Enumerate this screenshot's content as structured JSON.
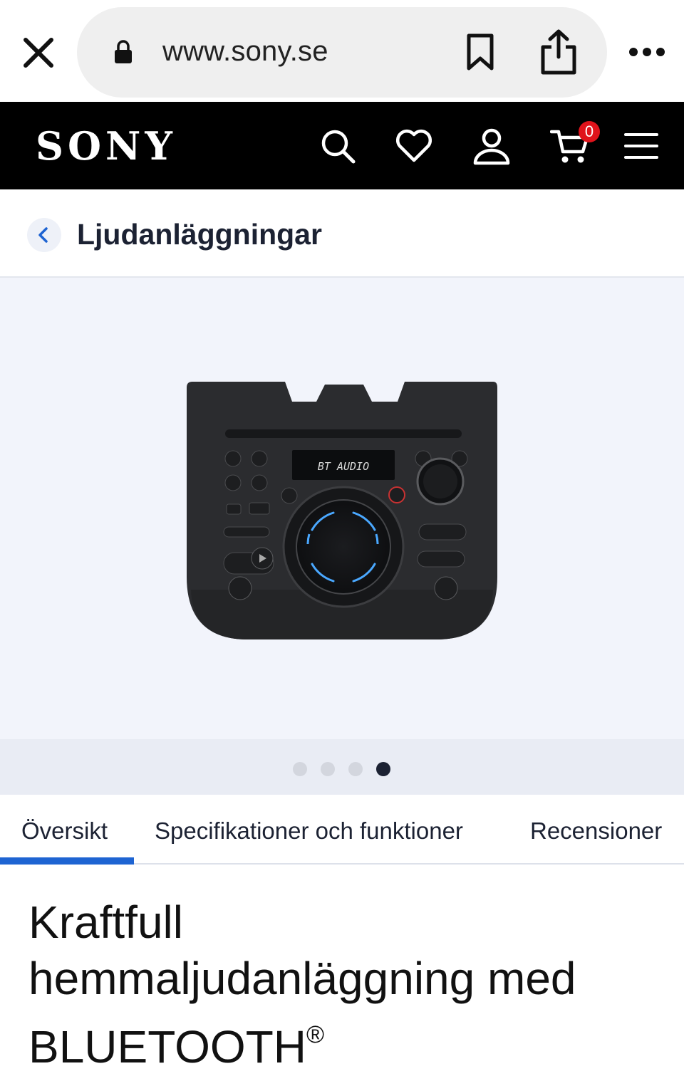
{
  "browser": {
    "url": "www.sony.se",
    "icons": {
      "close": "close-icon",
      "lock": "lock-icon",
      "bookmark": "bookmark-icon",
      "share": "share-icon",
      "more": "more-icon"
    }
  },
  "header": {
    "logo": "SONY",
    "cart_count": "0",
    "icons": [
      "search-icon",
      "heart-icon",
      "user-icon",
      "cart-icon",
      "menu-icon"
    ],
    "badge_color": "#e0131b"
  },
  "breadcrumb": {
    "label": "Ljudanläggningar"
  },
  "gallery": {
    "display_text": "BT AUDIO",
    "slide_count": 4,
    "active_slide": 4
  },
  "tabs": [
    {
      "label": "Översikt",
      "active": true
    },
    {
      "label": "Specifikationer och funktioner",
      "active": false
    },
    {
      "label": "Recensioner",
      "active": false
    }
  ],
  "headline": {
    "line1": "Kraftfull",
    "line2": "hemmaljudanläggning med",
    "line3": "BLUETOOTH",
    "mark": "®"
  },
  "colors": {
    "accent": "#1e64d2",
    "header_bg": "#000000",
    "gallery_bg": "#f2f4fb"
  }
}
